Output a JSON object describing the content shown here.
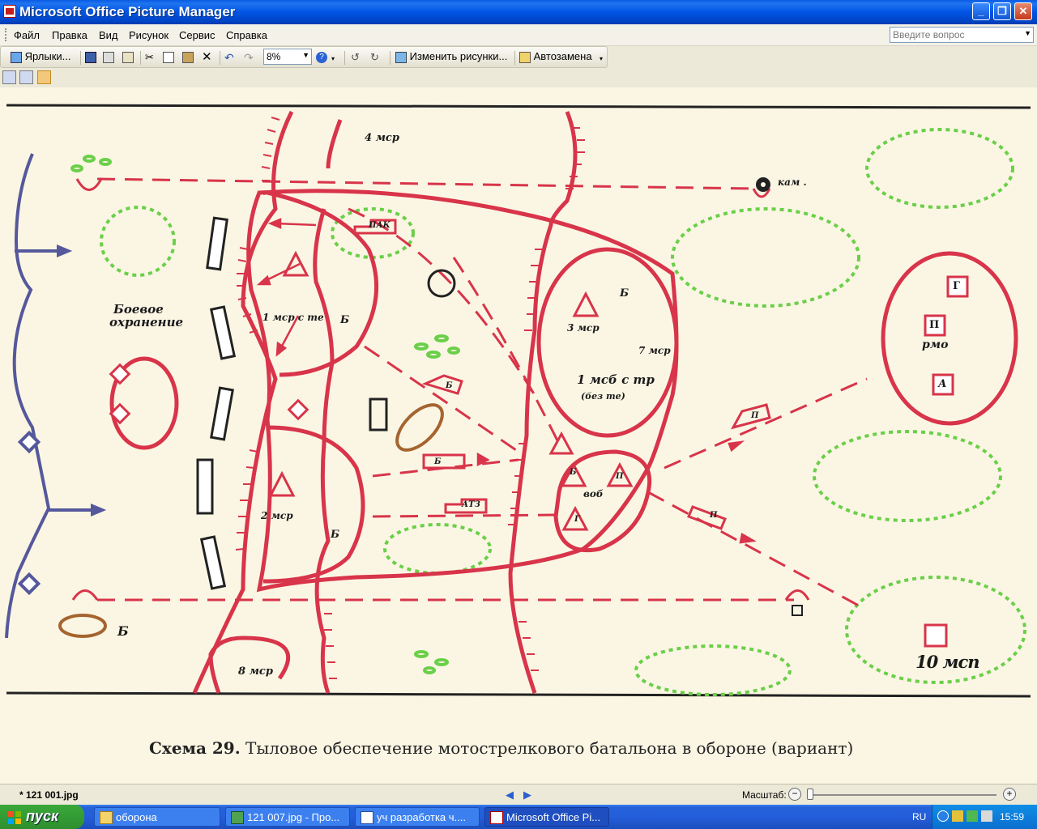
{
  "window": {
    "title": "Microsoft Office Picture Manager",
    "controls": {
      "minimize": "_",
      "maximize": "❐",
      "close": "✕"
    }
  },
  "menu": {
    "items": [
      "Файл",
      "Правка",
      "Вид",
      "Рисунок",
      "Сервис",
      "Справка"
    ],
    "ask_placeholder": "Введите вопрос"
  },
  "toolbar": {
    "shortcuts_label": "Ярлыки...",
    "zoom_value": "8%",
    "edit_pictures_label": "Изменить рисунки...",
    "autocorrect_label": "Автозамена"
  },
  "image": {
    "labels": {
      "company_4": "4 мср",
      "cam": "кам .",
      "pak": "ПАК",
      "combat_guard_1": "Боевое",
      "combat_guard_2": "охранение",
      "company_1": "1 мср с те",
      "b1": "Б",
      "b2": "Б",
      "b3": "Б",
      "b4": "Б",
      "b5": "Б",
      "b6": "Б",
      "company_3": "3 мср",
      "company_7": "7 мср",
      "battalion_1": "1 мсб с тр",
      "battalion_1b": "(без те)",
      "company_2": "2 мср",
      "ats": "АТЗ",
      "vob": "воб",
      "p1": "П",
      "p2": "П",
      "p3": "П",
      "p_rmo": "П",
      "g1": "Г",
      "g_rmo": "Г",
      "a_rmo": "А",
      "rmo": "рмо",
      "regiment_10": "10 мсп",
      "company_8": "8 мср",
      "b_bottom": "Б"
    },
    "caption_prefix": "Схема 29.",
    "caption_text": "Тыловое обеспечение мотострелкового батальона в обороне  (вариант)",
    "colors": {
      "red": "#d8344a",
      "green": "#6bcf49",
      "blue": "#55589b",
      "brown": "#a5642f",
      "paper": "#fbf6e4"
    }
  },
  "status": {
    "filename": "* 121 001.jpg",
    "zoom_label": "Масштаб:"
  },
  "taskbar": {
    "start_label": "пуск",
    "tasks": [
      "оборона",
      "121 007.jpg - Про...",
      "уч разработка ч....",
      "Microsoft Office Pi..."
    ],
    "lang": "RU",
    "clock": "15:59"
  }
}
